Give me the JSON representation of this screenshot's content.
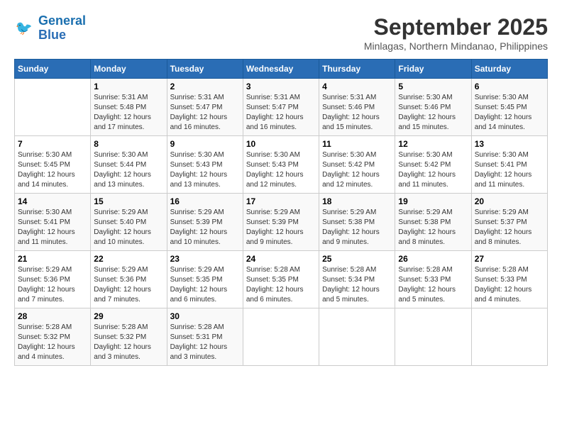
{
  "logo": {
    "line1": "General",
    "line2": "Blue"
  },
  "title": "September 2025",
  "subtitle": "Minlagas, Northern Mindanao, Philippines",
  "weekdays": [
    "Sunday",
    "Monday",
    "Tuesday",
    "Wednesday",
    "Thursday",
    "Friday",
    "Saturday"
  ],
  "weeks": [
    [
      {
        "day": "",
        "info": ""
      },
      {
        "day": "1",
        "info": "Sunrise: 5:31 AM\nSunset: 5:48 PM\nDaylight: 12 hours\nand 17 minutes."
      },
      {
        "day": "2",
        "info": "Sunrise: 5:31 AM\nSunset: 5:47 PM\nDaylight: 12 hours\nand 16 minutes."
      },
      {
        "day": "3",
        "info": "Sunrise: 5:31 AM\nSunset: 5:47 PM\nDaylight: 12 hours\nand 16 minutes."
      },
      {
        "day": "4",
        "info": "Sunrise: 5:31 AM\nSunset: 5:46 PM\nDaylight: 12 hours\nand 15 minutes."
      },
      {
        "day": "5",
        "info": "Sunrise: 5:30 AM\nSunset: 5:46 PM\nDaylight: 12 hours\nand 15 minutes."
      },
      {
        "day": "6",
        "info": "Sunrise: 5:30 AM\nSunset: 5:45 PM\nDaylight: 12 hours\nand 14 minutes."
      }
    ],
    [
      {
        "day": "7",
        "info": "Sunrise: 5:30 AM\nSunset: 5:45 PM\nDaylight: 12 hours\nand 14 minutes."
      },
      {
        "day": "8",
        "info": "Sunrise: 5:30 AM\nSunset: 5:44 PM\nDaylight: 12 hours\nand 13 minutes."
      },
      {
        "day": "9",
        "info": "Sunrise: 5:30 AM\nSunset: 5:43 PM\nDaylight: 12 hours\nand 13 minutes."
      },
      {
        "day": "10",
        "info": "Sunrise: 5:30 AM\nSunset: 5:43 PM\nDaylight: 12 hours\nand 12 minutes."
      },
      {
        "day": "11",
        "info": "Sunrise: 5:30 AM\nSunset: 5:42 PM\nDaylight: 12 hours\nand 12 minutes."
      },
      {
        "day": "12",
        "info": "Sunrise: 5:30 AM\nSunset: 5:42 PM\nDaylight: 12 hours\nand 11 minutes."
      },
      {
        "day": "13",
        "info": "Sunrise: 5:30 AM\nSunset: 5:41 PM\nDaylight: 12 hours\nand 11 minutes."
      }
    ],
    [
      {
        "day": "14",
        "info": "Sunrise: 5:30 AM\nSunset: 5:41 PM\nDaylight: 12 hours\nand 11 minutes."
      },
      {
        "day": "15",
        "info": "Sunrise: 5:29 AM\nSunset: 5:40 PM\nDaylight: 12 hours\nand 10 minutes."
      },
      {
        "day": "16",
        "info": "Sunrise: 5:29 AM\nSunset: 5:39 PM\nDaylight: 12 hours\nand 10 minutes."
      },
      {
        "day": "17",
        "info": "Sunrise: 5:29 AM\nSunset: 5:39 PM\nDaylight: 12 hours\nand 9 minutes."
      },
      {
        "day": "18",
        "info": "Sunrise: 5:29 AM\nSunset: 5:38 PM\nDaylight: 12 hours\nand 9 minutes."
      },
      {
        "day": "19",
        "info": "Sunrise: 5:29 AM\nSunset: 5:38 PM\nDaylight: 12 hours\nand 8 minutes."
      },
      {
        "day": "20",
        "info": "Sunrise: 5:29 AM\nSunset: 5:37 PM\nDaylight: 12 hours\nand 8 minutes."
      }
    ],
    [
      {
        "day": "21",
        "info": "Sunrise: 5:29 AM\nSunset: 5:36 PM\nDaylight: 12 hours\nand 7 minutes."
      },
      {
        "day": "22",
        "info": "Sunrise: 5:29 AM\nSunset: 5:36 PM\nDaylight: 12 hours\nand 7 minutes."
      },
      {
        "day": "23",
        "info": "Sunrise: 5:29 AM\nSunset: 5:35 PM\nDaylight: 12 hours\nand 6 minutes."
      },
      {
        "day": "24",
        "info": "Sunrise: 5:28 AM\nSunset: 5:35 PM\nDaylight: 12 hours\nand 6 minutes."
      },
      {
        "day": "25",
        "info": "Sunrise: 5:28 AM\nSunset: 5:34 PM\nDaylight: 12 hours\nand 5 minutes."
      },
      {
        "day": "26",
        "info": "Sunrise: 5:28 AM\nSunset: 5:33 PM\nDaylight: 12 hours\nand 5 minutes."
      },
      {
        "day": "27",
        "info": "Sunrise: 5:28 AM\nSunset: 5:33 PM\nDaylight: 12 hours\nand 4 minutes."
      }
    ],
    [
      {
        "day": "28",
        "info": "Sunrise: 5:28 AM\nSunset: 5:32 PM\nDaylight: 12 hours\nand 4 minutes."
      },
      {
        "day": "29",
        "info": "Sunrise: 5:28 AM\nSunset: 5:32 PM\nDaylight: 12 hours\nand 3 minutes."
      },
      {
        "day": "30",
        "info": "Sunrise: 5:28 AM\nSunset: 5:31 PM\nDaylight: 12 hours\nand 3 minutes."
      },
      {
        "day": "",
        "info": ""
      },
      {
        "day": "",
        "info": ""
      },
      {
        "day": "",
        "info": ""
      },
      {
        "day": "",
        "info": ""
      }
    ]
  ]
}
